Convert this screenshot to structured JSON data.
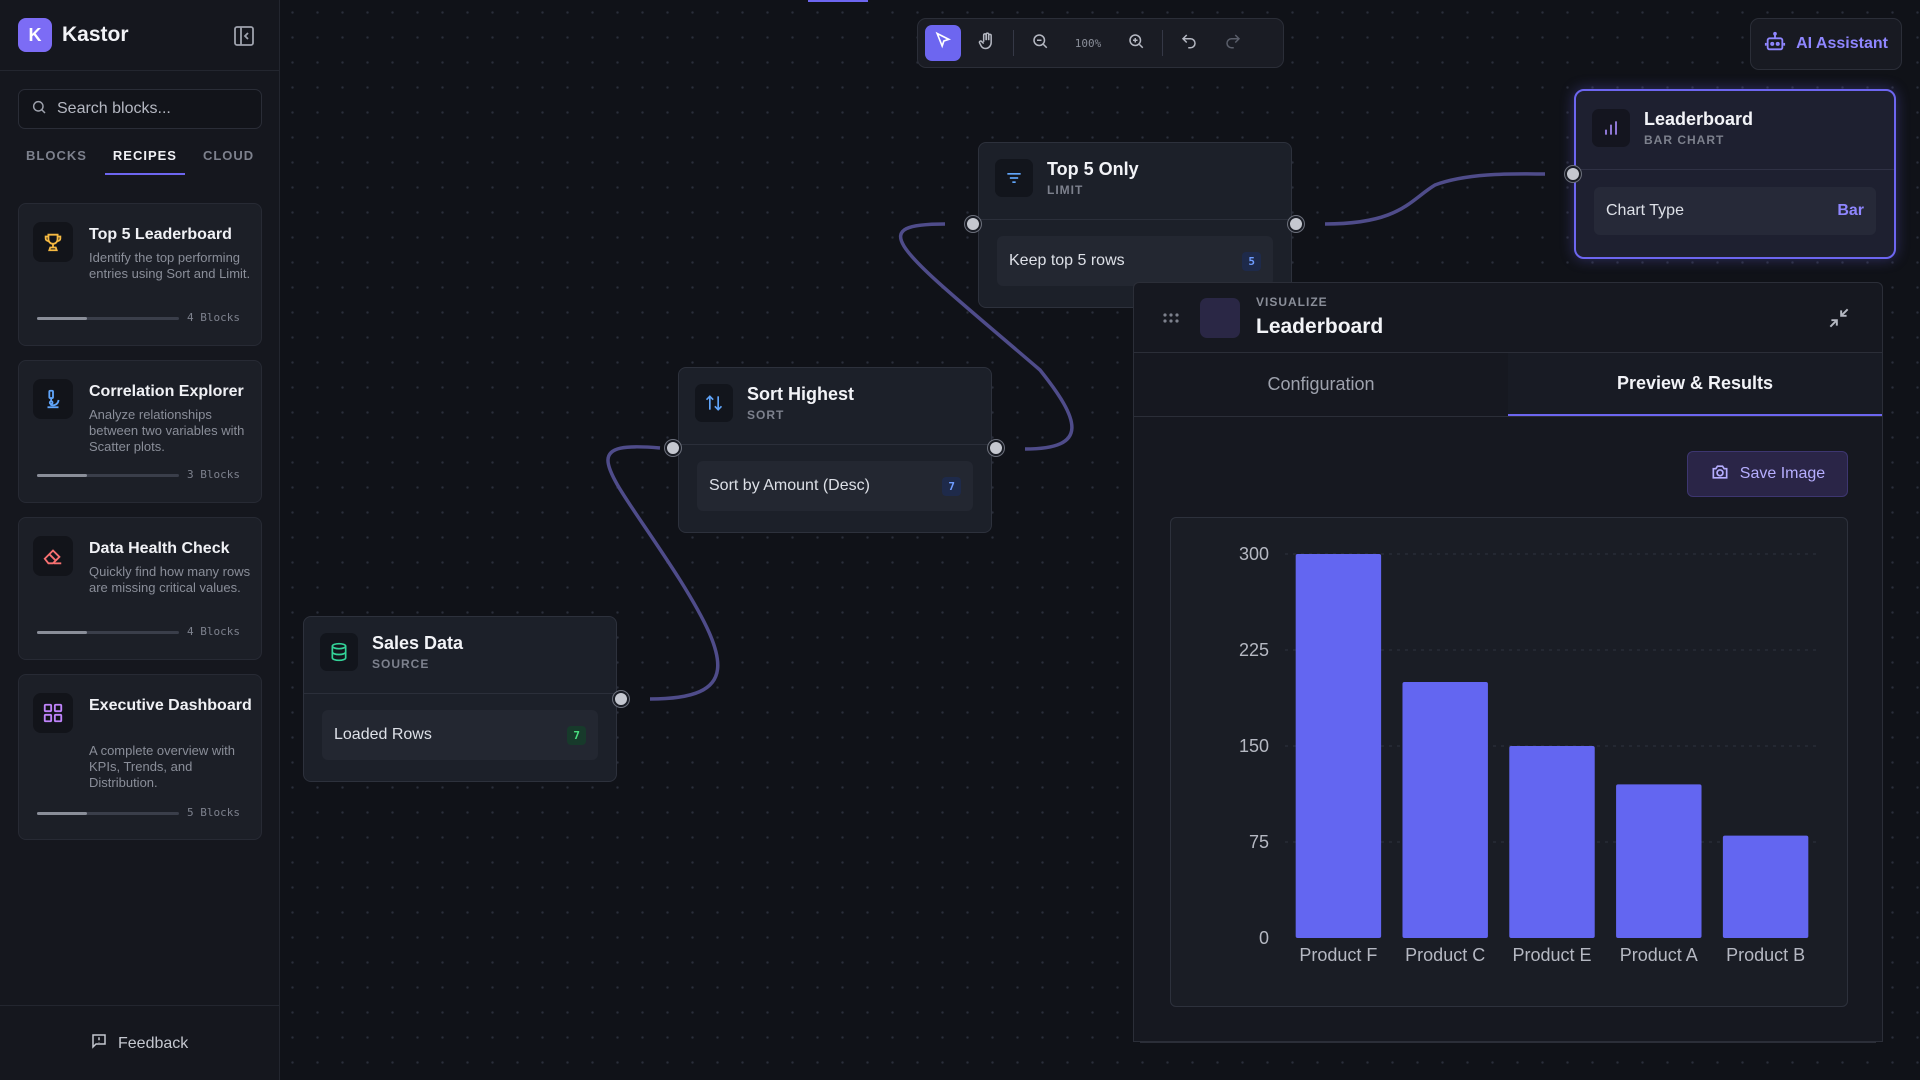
{
  "app": {
    "logo_letter": "K",
    "name": "Kastor"
  },
  "sidebar": {
    "search_placeholder": "Search blocks...",
    "tabs": [
      {
        "label": "BLOCKS",
        "active": false
      },
      {
        "label": "RECIPES",
        "active": true
      },
      {
        "label": "CLOUD",
        "active": false
      }
    ],
    "recipes": [
      {
        "title": "Top 5 Leaderboard",
        "desc": "Identify the top performing entries using Sort and Limit.",
        "count": "4 Blocks",
        "icon": "trophy-icon",
        "progress": 0.35
      },
      {
        "title": "Correlation Explorer",
        "desc": "Analyze relationships between two variables with Scatter plots.",
        "count": "3 Blocks",
        "icon": "microscope-icon",
        "progress": 0.35
      },
      {
        "title": "Data Health Check",
        "desc": "Quickly find how many rows are missing critical values.",
        "count": "4 Blocks",
        "icon": "eraser-icon",
        "progress": 0.35
      },
      {
        "title": "Executive Dashboard",
        "desc": "A complete overview with KPIs, Trends, and Distribution.",
        "count": "5 Blocks",
        "icon": "dashboard-icon",
        "progress": 0.35
      }
    ],
    "feedback_label": "Feedback"
  },
  "toolbar": {
    "zoom": "100%"
  },
  "ai_assistant_label": "AI Assistant",
  "nodes": {
    "sales": {
      "title": "Sales Data",
      "type": "SOURCE",
      "row_label": "Loaded Rows",
      "row_value": "7"
    },
    "sort": {
      "title": "Sort Highest",
      "type": "SORT",
      "row_label": "Sort by Amount (Desc)",
      "row_value": "7"
    },
    "limit": {
      "title": "Top 5 Only",
      "type": "LIMIT",
      "row_label": "Keep top 5 rows",
      "row_value": "5"
    },
    "leaderboard": {
      "title": "Leaderboard",
      "type": "BAR CHART",
      "row_label": "Chart Type",
      "row_value": "Bar"
    }
  },
  "panel": {
    "category": "VISUALIZE",
    "title": "Leaderboard",
    "tabs": [
      {
        "label": "Configuration",
        "active": false
      },
      {
        "label": "Preview & Results",
        "active": true
      }
    ],
    "save_label": "Save Image"
  },
  "colors": {
    "accent": "#6d66f0",
    "bar": "#6366f1"
  },
  "chart_data": {
    "type": "bar",
    "categories": [
      "Product F",
      "Product C",
      "Product E",
      "Product A",
      "Product B"
    ],
    "values": [
      300,
      200,
      150,
      120,
      80
    ],
    "yticks": [
      0,
      75,
      150,
      225,
      300
    ],
    "ylim": [
      0,
      300
    ],
    "title": "",
    "xlabel": "",
    "ylabel": "",
    "grid": true
  }
}
